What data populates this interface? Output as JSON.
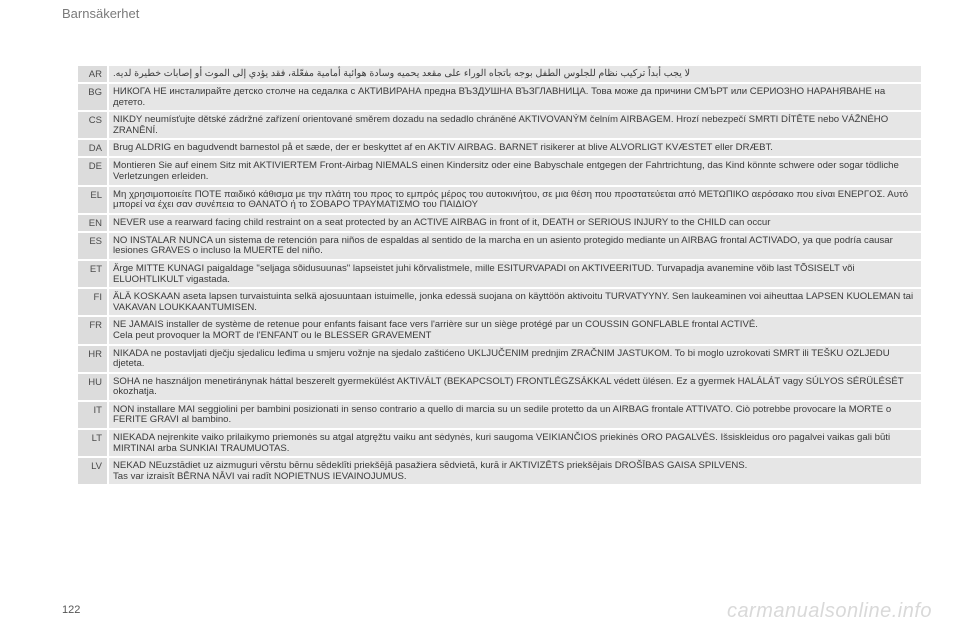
{
  "header": {
    "section_title": "Barnsäkerhet"
  },
  "rows": [
    {
      "code": "AR",
      "text": "لا يجب أبداً تركيب نظام للجلوس الطفل بوجه باتجاه الوراء على مقعد يحميه وسادة هوائية أمامية مفعّلة، فقد يؤدي إلى الموت أو إصابات خطيرة لديه.",
      "rtl": true
    },
    {
      "code": "BG",
      "text": "НИКОГА НЕ инсталирайте детско столче на седалка с АКТИВИРАНА предна ВЪЗДУШНА ВЪЗГЛАВНИЦА. Това може да причини СМЪРТ или СЕРИОЗНО НАРАНЯВАНЕ на детето."
    },
    {
      "code": "CS",
      "text": "NIKDY neumísťujte dětské zádržné zařízení orientované směrem dozadu na sedadlo chráněné AKTIVOVANÝM čelním AIRBAGEM. Hrozí nebezpečí SMRTI DÍTĚTE nebo VÁŽNÉHO ZRANĚNÍ."
    },
    {
      "code": "DA",
      "text": "Brug ALDRIG en bagudvendt barnestol på et sæde, der er beskyttet af en AKTIV AIRBAG. BARNET risikerer at blive ALVORLIGT KVÆSTET eller DRÆBT."
    },
    {
      "code": "DE",
      "text": "Montieren Sie auf einem Sitz mit AKTIVIERTEM Front-Airbag NIEMALS einen Kindersitz oder eine Babyschale entgegen der Fahrtrichtung, das Kind könnte schwere oder sogar tödliche Verletzungen erleiden."
    },
    {
      "code": "EL",
      "text": "Μη χρησιμοποιείτε ΠΟΤΕ παιδικό κάθισμα με την πλάτη του προς το εμπρός μέρος του αυτοκινήτου, σε μια θέση που προστατεύεται από ΜΕΤΩΠΙΚΟ αερόσακο που είναι ΕΝΕΡΓΟΣ. Αυτό μπορεί να έχει σαν συνέπεια το ΘΑΝΑΤΟ ή το ΣΟΒΑΡΟ ΤΡΑΥΜΑΤΙΣΜΟ του ΠΑΙΔΙΟΥ"
    },
    {
      "code": "EN",
      "text": "NEVER use a rearward facing child restraint on a seat protected by an ACTIVE AIRBAG in front of it, DEATH or SERIOUS INJURY to the CHILD can occur"
    },
    {
      "code": "ES",
      "text": "NO INSTALAR NUNCA un sistema de retención para niños de espaldas al sentido de la marcha en un asiento protegido mediante un AIRBAG frontal ACTIVADO, ya que podría causar lesiones GRAVES o incluso la MUERTE del niño."
    },
    {
      "code": "ET",
      "text": "Ärge MITTE KUNAGI paigaldage \"seljaga sõidusuunas\" lapseistet juhi kõrvalistmele, mille ESITURVAPADI on AKTIVEERITUD. Turvapadja avanemine võib last TÕSISELT või ELUOHTLIKULT vigastada."
    },
    {
      "code": "FI",
      "text": "ÄLÄ KOSKAAN aseta lapsen turvaistuinta selkä ajosuuntaan istuimelle, jonka edessä suojana on käyttöön aktivoitu TURVATYYNY. Sen laukeaminen voi aiheuttaa LAPSEN KUOLEMAN tai VAKAVAN LOUKKAANTUMISEN."
    },
    {
      "code": "FR",
      "text": "NE JAMAIS installer de système de retenue pour enfants faisant face vers l'arrière sur un siège protégé par un COUSSIN GONFLABLE frontal ACTIVÉ.\nCela peut provoquer la MORT de l'ENFANT ou le BLESSER GRAVEMENT"
    },
    {
      "code": "HR",
      "text": "NIKADA ne postavljati dječju sjedalicu leđima u smjeru vožnje na sjedalo zaštićeno UKLJUČENIM prednjim ZRAČNIM JASTUKOM. To bi moglo uzrokovati SMRT ili TEŠKU OZLJEDU djeteta."
    },
    {
      "code": "HU",
      "text": "SOHA ne használjon menetiránynak háttal beszerelt gyermekülést AKTIVÁLT (BEKAPCSOLT) FRONTLÉGZSÁKKAL védett ülésen. Ez a gyermek HALÁLÁT vagy SÚLYOS SÉRÜLÉSÉT okozhatja."
    },
    {
      "code": "IT",
      "text": "NON installare MAI seggiolini per bambini posizionati in senso contrario a quello di marcia su un sedile protetto da un AIRBAG frontale ATTIVATO. Ciò potrebbe provocare la MORTE o FERITE GRAVI al bambino."
    },
    {
      "code": "LT",
      "text": "NIEKADA neįrenkite vaiko prilaikymo priemonės su atgal atgręžtu vaiku ant sėdynės, kuri saugoma VEIKIANČIOS priekinės ORO PAGALVĖS. Išsiskleidus oro pagalvei vaikas gali būti MIRTINAI arba SUNKIAI TRAUMUOTAS."
    },
    {
      "code": "LV",
      "text": "NEKAD NEuzstādiet uz aizmuguri vērstu bērnu sēdeklīti priekšējā pasažiera sēdvietā, kurā ir AKTIVIZĒTS priekšējais DROŠĪBAS GAISA SPILVENS.\nTas var izraisīt BĒRNA NĀVI vai radīt NOPIETNUS IEVAINOJUMUS."
    }
  ],
  "footer": {
    "page_number": "122",
    "watermark": "carmanualsonline.info"
  }
}
